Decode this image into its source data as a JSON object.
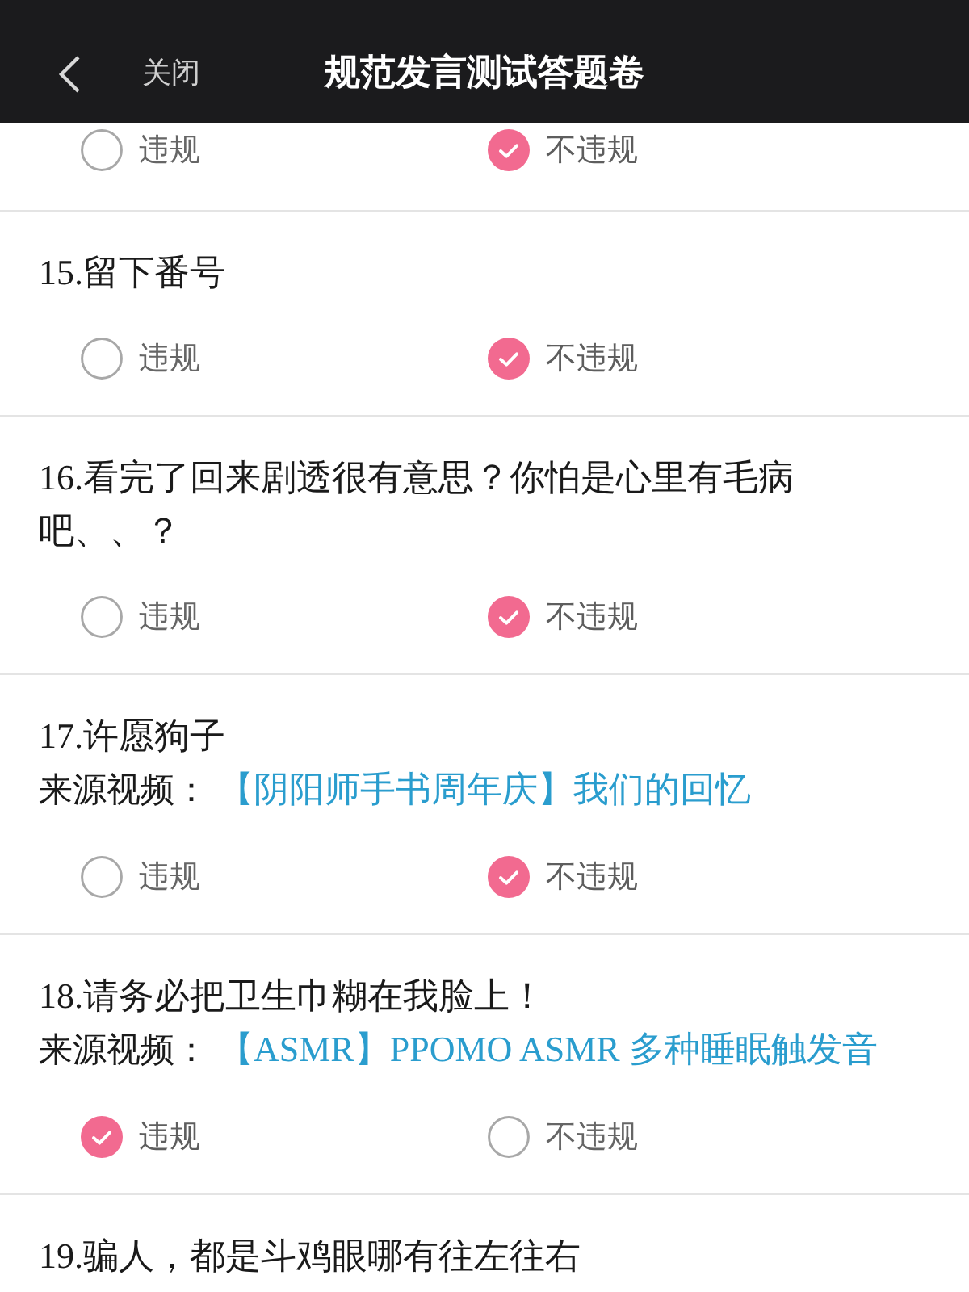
{
  "header": {
    "close_label": "关闭",
    "title": "规范发言测试答题卷"
  },
  "questions": [
    {
      "options": [
        {
          "label": "违规",
          "selected": false
        },
        {
          "label": "不违规",
          "selected": true
        }
      ]
    },
    {
      "text": "15.留下番号",
      "options": [
        {
          "label": "违规",
          "selected": false
        },
        {
          "label": "不违规",
          "selected": true
        }
      ]
    },
    {
      "text": "16.看完了回来剧透很有意思？你怕是心里有毛病吧、、？",
      "options": [
        {
          "label": "违规",
          "selected": false
        },
        {
          "label": "不违规",
          "selected": true
        }
      ]
    },
    {
      "text": "17.许愿狗子",
      "source": {
        "label": "来源视频：",
        "link": "【阴阳师手书周年庆】我们的回忆"
      },
      "options": [
        {
          "label": "违规",
          "selected": false
        },
        {
          "label": "不违规",
          "selected": true
        }
      ]
    },
    {
      "text": "18.请务必把卫生巾糊在我脸上！",
      "source": {
        "label": "来源视频：",
        "link": "【ASMR】PPOMO ASMR 多种睡眠触发音"
      },
      "options": [
        {
          "label": "违规",
          "selected": true
        },
        {
          "label": "不违规",
          "selected": false
        }
      ]
    },
    {
      "text": "19.骗人，都是斗鸡眼哪有往左往右"
    }
  ]
}
